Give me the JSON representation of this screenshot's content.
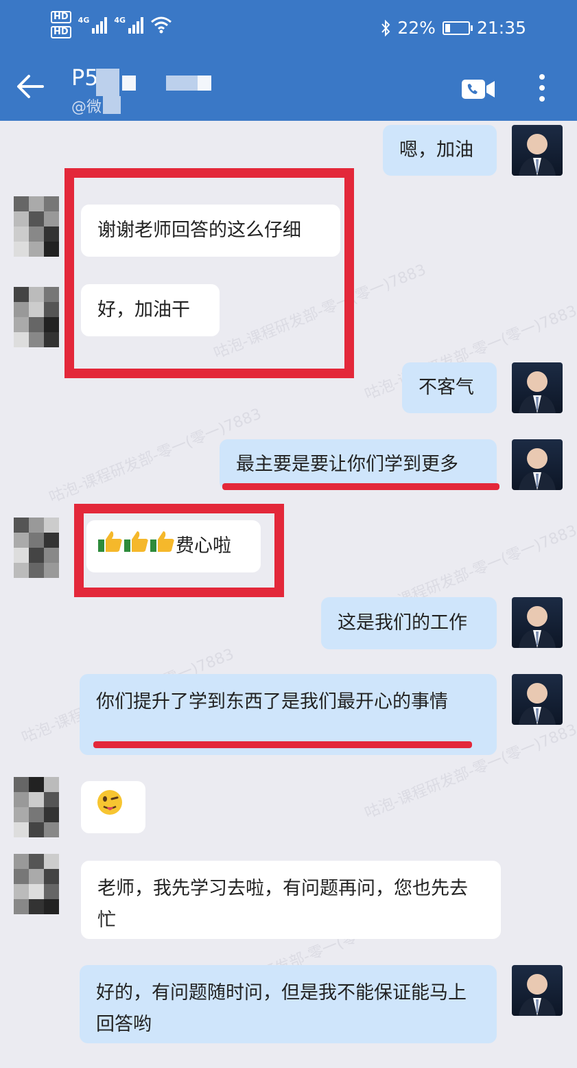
{
  "status_bar": {
    "signal_type_1": "4G",
    "signal_type_2": "4G",
    "hd1": "HD",
    "hd2": "HD",
    "battery": "22%",
    "battery_level": 0.22,
    "time": "21:35"
  },
  "header": {
    "contact_name": "P5",
    "contact_sub": "@微"
  },
  "watermark": "咕泡-课程研发部-零一(零一)7883",
  "messages": [
    {
      "side": "me",
      "text": "嗯，加油"
    },
    {
      "side": "them",
      "text": "谢谢老师回答的这么仔细"
    },
    {
      "side": "them",
      "text": "好，加油干"
    },
    {
      "side": "me",
      "text": "不客气"
    },
    {
      "side": "me",
      "text": "最主要是要让你们学到更多"
    },
    {
      "side": "them",
      "text": "费心啦"
    },
    {
      "side": "me",
      "text": "这是我们的工作"
    },
    {
      "side": "me",
      "text": "你们提升了学到东西了是我们最开心的事情"
    },
    {
      "side": "them",
      "text": ""
    },
    {
      "side": "them",
      "text": "老师，我先学习去啦，有问题再问，您也先去忙"
    },
    {
      "side": "me",
      "text": "好的，有问题随时问，但是我不能保证能马上回答哟"
    }
  ],
  "icons": {
    "back": "arrow-left-icon",
    "video_call": "video-call-icon",
    "menu": "more-vertical-icon",
    "thumbs": "thumbs-up-icon",
    "wink": "wink-tongue-emoji"
  },
  "colors": {
    "header": "#3a78c6",
    "chat_bg": "#ebebf1",
    "my_bubble": "#cfe5fb",
    "their_bubble": "#ffffff",
    "highlight": "#e3283a"
  }
}
